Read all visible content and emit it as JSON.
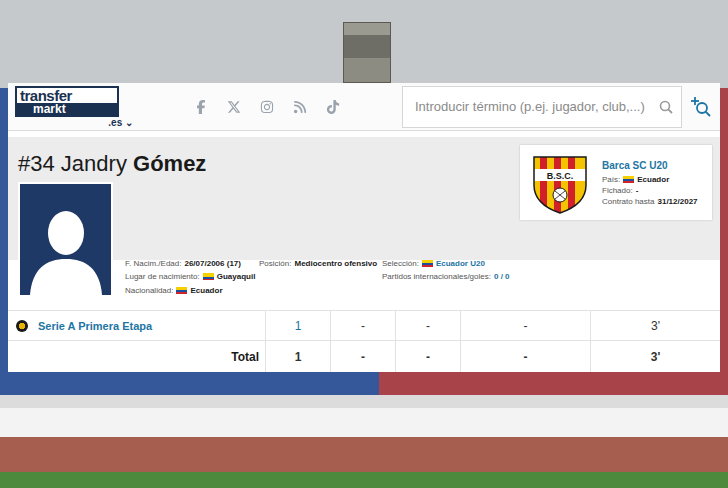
{
  "header": {
    "logo": {
      "top": "transfer",
      "bottom": "markt"
    },
    "domain": ".es",
    "search": {
      "placeholder": "Introducir término (p.ej. jugador, club,...)"
    }
  },
  "player": {
    "number": "#34",
    "first_name": "Jandry",
    "last_name": "Gómez",
    "fact_columns": [
      [
        {
          "label": "F. Nacim./Edad:",
          "value": "26/07/2006 (17)",
          "flag": false,
          "link": false
        },
        {
          "label": "Lugar de nacimiento:",
          "value": "Guayaquil",
          "flag": true,
          "link": false
        },
        {
          "label": "Nacionalidad:",
          "value": "Ecuador",
          "flag": true,
          "link": false
        }
      ],
      [
        {
          "label": "Posición:",
          "value": "Mediocentro ofensivo",
          "flag": false,
          "link": false
        }
      ],
      [
        {
          "label": "Selección:",
          "value": "Ecuador U20",
          "flag": true,
          "link": true
        },
        {
          "label": "Partidos internacionales/goles:",
          "value": "0 / 0",
          "flag": false,
          "link": true
        }
      ]
    ]
  },
  "club": {
    "name": "Barca SC U20",
    "logo_text": "B.S.C.",
    "facts": [
      {
        "label": "País:",
        "value": "Ecuador",
        "flag": true
      },
      {
        "label": "Fichado:",
        "value": "-",
        "flag": false
      },
      {
        "label": "Contrato hasta",
        "value": "31/12/2027",
        "flag": false
      }
    ]
  },
  "stats": {
    "rows": [
      {
        "competition": "Serie A Primera Etapa",
        "values": [
          {
            "text": "1",
            "link": true
          },
          {
            "text": "-",
            "link": false
          },
          {
            "text": "-",
            "link": false
          },
          {
            "text": "-",
            "link": false
          },
          {
            "text": "3'",
            "link": false
          }
        ]
      }
    ],
    "total": {
      "label": "Total",
      "values": [
        "1",
        "-",
        "-",
        "-",
        "3'"
      ]
    }
  }
}
